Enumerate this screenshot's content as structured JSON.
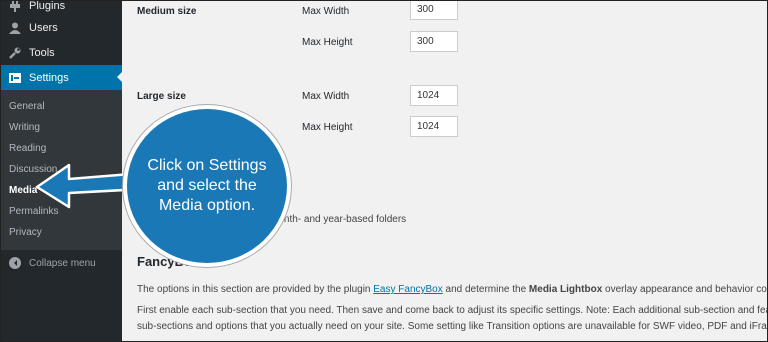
{
  "sidebar": {
    "items": [
      {
        "label": "Plugins",
        "icon": "plugin-icon"
      },
      {
        "label": "Users",
        "icon": "users-icon"
      },
      {
        "label": "Tools",
        "icon": "wrench-icon"
      },
      {
        "label": "Settings",
        "icon": "settings-icon"
      }
    ],
    "submenu": [
      "General",
      "Writing",
      "Reading",
      "Discussion",
      "Media",
      "Permalinks",
      "Privacy"
    ],
    "collapse_label": "Collapse menu"
  },
  "media": {
    "medium": {
      "label": "Medium size",
      "width_label": "Max Width",
      "width": "300",
      "height_label": "Max Height",
      "height": "300"
    },
    "large": {
      "label": "Large size",
      "width_label": "Max Width",
      "width": "1024",
      "height_label": "Max Height",
      "height": "1024"
    },
    "uploads_text": "month- and year-based folders"
  },
  "fancybox": {
    "heading": "FancyBox",
    "p1_before": "The options in this section are provided by the plugin ",
    "p1_link": "Easy FancyBox",
    "p1_mid": " and determine the ",
    "p1_bold": "Media Lightbox",
    "p1_after": " overlay appearance and behavior controll",
    "p2_line1": "First enable each sub-section that you need. Then save and come back to adjust its specific settings. Note: Each additional sub-section and features",
    "p2_line2": "sub-sections and options that you actually need on your site. Some setting like Transition options are unavailable for SWF video, PDF and iFrame co"
  },
  "callout": {
    "text": "Click on Settings and select the Media option."
  },
  "colors": {
    "accent": "#0073aa",
    "callout": "#1b78b7",
    "sidebar": "#23282d"
  }
}
